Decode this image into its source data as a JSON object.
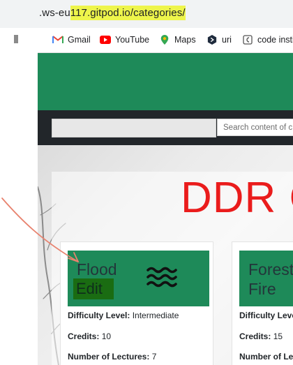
{
  "browser": {
    "url_before": ".ws-eu",
    "url_highlight": "117.gitpod.io/categories/",
    "bookmarks": [
      {
        "label": "Gmail",
        "icon": "gmail-icon"
      },
      {
        "label": "YouTube",
        "icon": "youtube-icon"
      },
      {
        "label": "Maps",
        "icon": "maps-icon"
      },
      {
        "label": "uri",
        "icon": "uri-icon"
      },
      {
        "label": "code instit",
        "icon": "code-institute-icon"
      }
    ]
  },
  "site": {
    "search_placeholder": "Search content of c",
    "title": "DDR C",
    "colors": {
      "green": "#1e8a59",
      "nav": "#22262a",
      "title": "#ea1c1c",
      "edit": "#1a6c12"
    }
  },
  "cards": [
    {
      "name": "Flood",
      "edit_label": "Edit",
      "icon": "water-waves-icon",
      "difficulty_label": "Difficulty Level:",
      "difficulty_value": "Intermediate",
      "credits_label": "Credits:",
      "credits_value": "10",
      "lectures_label": "Number of Lectures:",
      "lectures_value": "7"
    },
    {
      "name": "Forest Fire",
      "difficulty_label": "Difficulty Leve",
      "credits_label": "Credits:",
      "credits_value": "15",
      "lectures_label": "Number of Lec"
    }
  ]
}
